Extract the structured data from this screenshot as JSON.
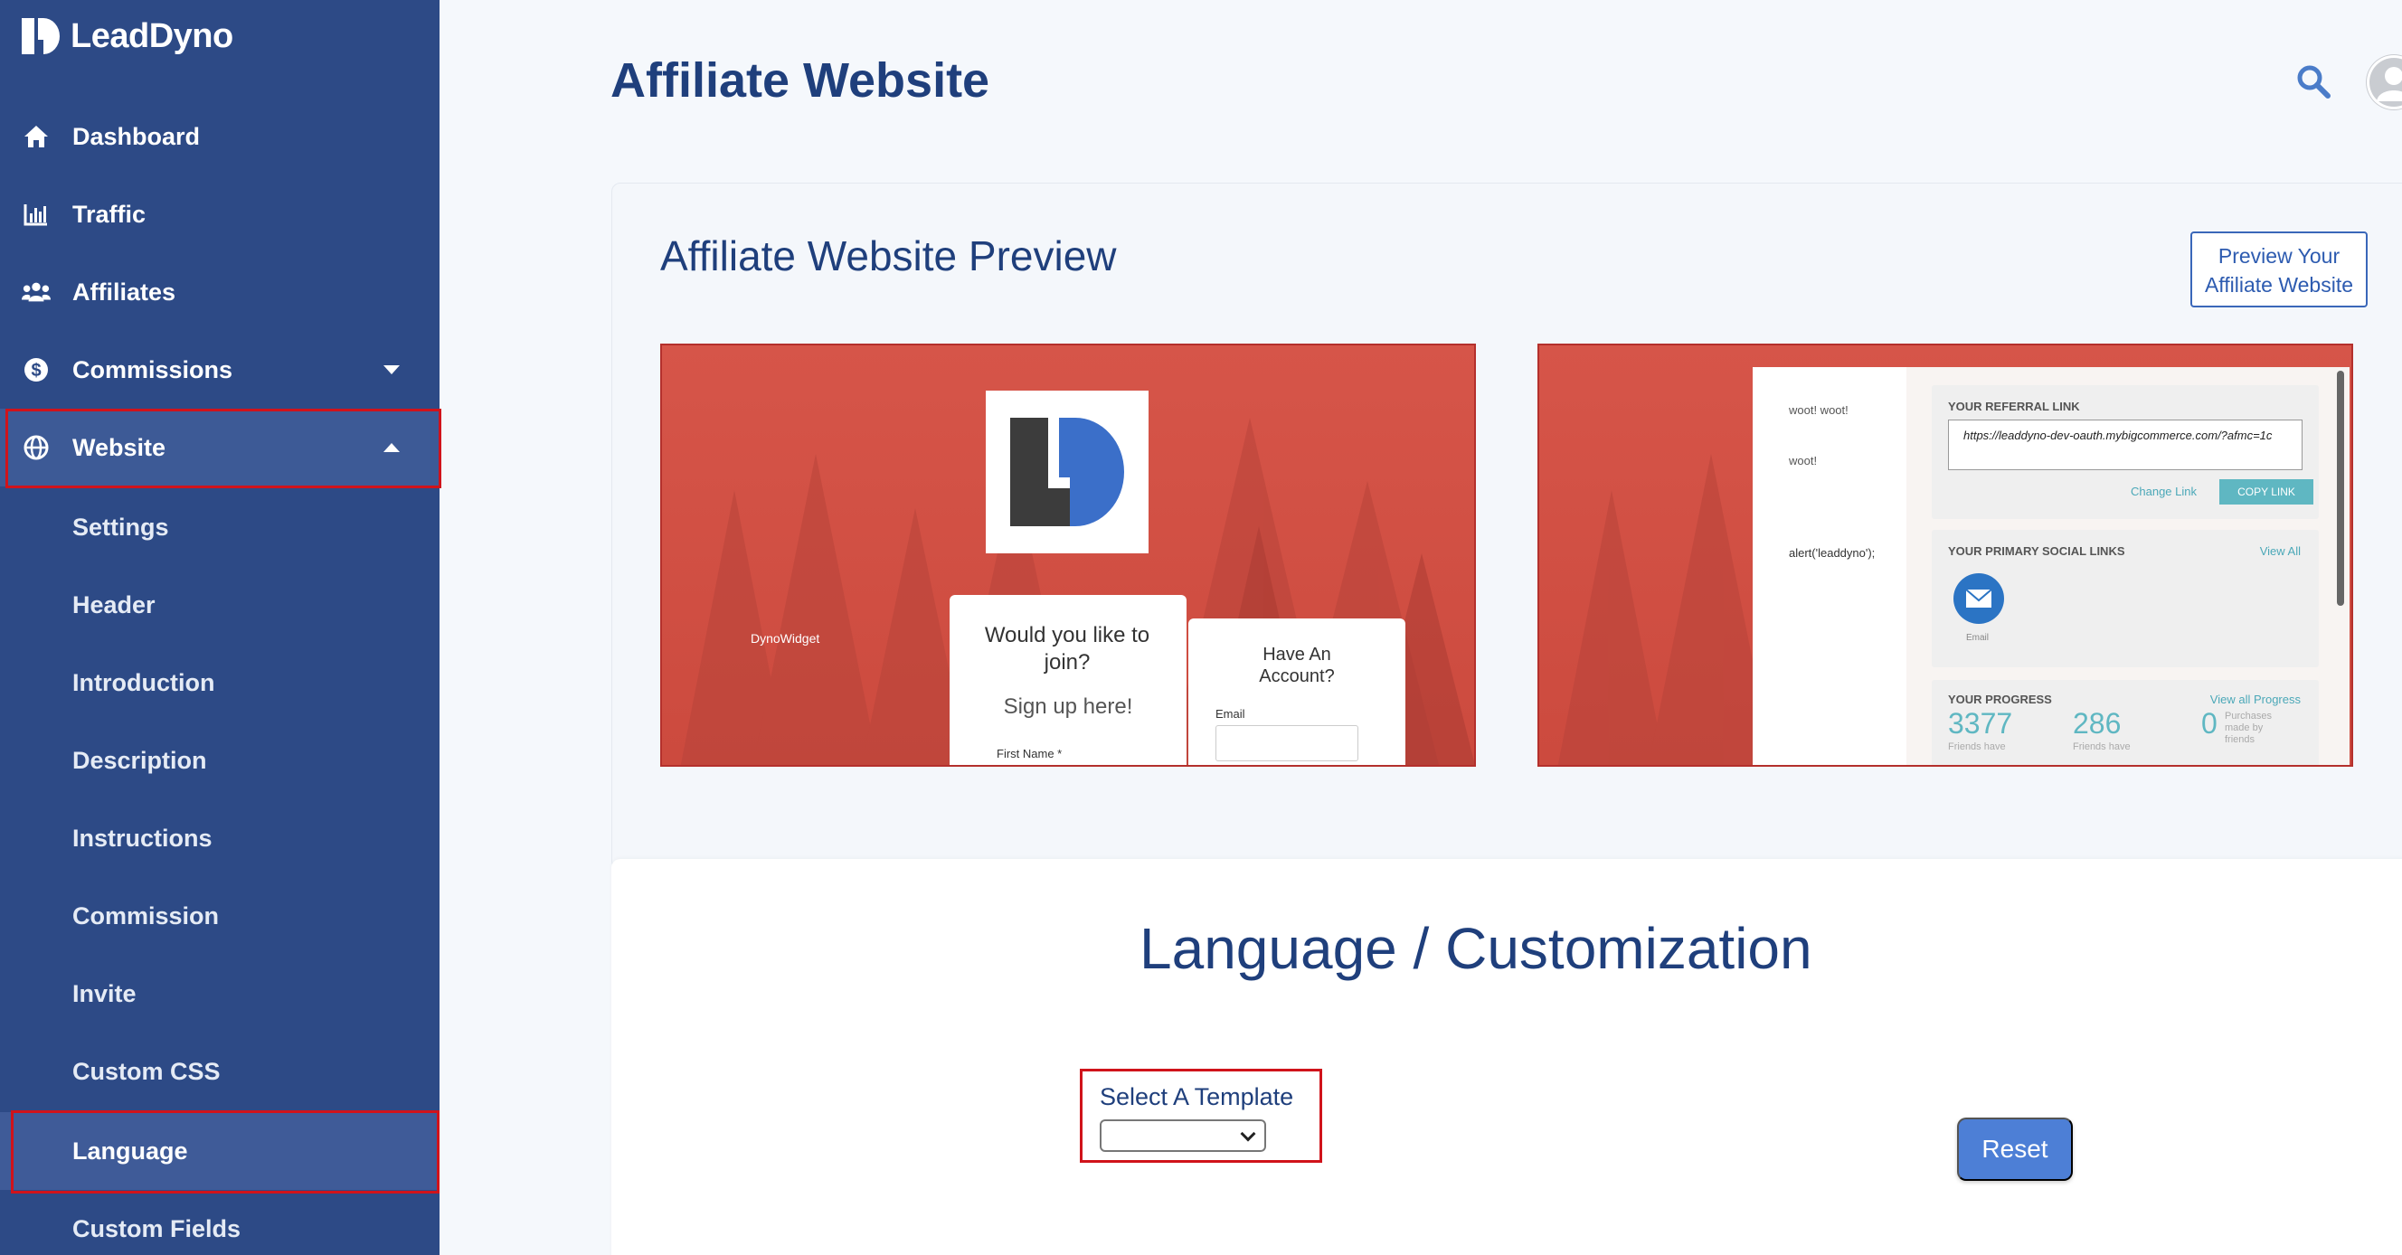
{
  "app": {
    "name": "LeadDyno"
  },
  "sidebar": {
    "items": [
      {
        "label": "Dashboard",
        "icon": "home-icon"
      },
      {
        "label": "Traffic",
        "icon": "bar-chart-icon"
      },
      {
        "label": "Affiliates",
        "icon": "users-icon"
      },
      {
        "label": "Commissions",
        "icon": "dollar-icon",
        "expanded": false
      },
      {
        "label": "Website",
        "icon": "globe-icon",
        "expanded": true
      }
    ],
    "website_sub": [
      {
        "label": "Settings"
      },
      {
        "label": "Header"
      },
      {
        "label": "Introduction"
      },
      {
        "label": "Description"
      },
      {
        "label": "Instructions"
      },
      {
        "label": "Commission"
      },
      {
        "label": "Invite"
      },
      {
        "label": "Custom CSS"
      },
      {
        "label": "Language",
        "active": true
      },
      {
        "label": "Custom Fields"
      }
    ]
  },
  "header": {
    "title": "Affiliate Website"
  },
  "preview": {
    "title": "Affiliate Website Preview",
    "button_line1": "Preview Your",
    "button_line2": "Affiliate Website",
    "left": {
      "widget_label": "DynoWidget",
      "join_title": "Would you like to join?",
      "signup": "Sign up here!",
      "first_name": "First Name *",
      "have_account": "Have An Account?",
      "email": "Email"
    },
    "right": {
      "woot1": "woot! woot!",
      "woot2": "woot!",
      "alert": "alert('leaddyno');",
      "referral_header": "YOUR REFERRAL LINK",
      "referral_url": "https://leaddyno-dev-oauth.mybigcommerce.com/?afmc=1c",
      "change_link": "Change Link",
      "copy_link": "COPY LINK",
      "social_header": "YOUR PRIMARY SOCIAL LINKS",
      "view_all": "View All",
      "email_label": "Email",
      "progress_header": "YOUR PROGRESS",
      "view_all_progress": "View all Progress",
      "stat1_value": "3377",
      "stat1_label": "Friends have",
      "stat2_value": "286",
      "stat2_label": "Friends have",
      "stat3_value": "0",
      "stat3_label": "Purchases made by friends"
    }
  },
  "language": {
    "title": "Language / Customization",
    "select_label": "Select A Template",
    "select_value": "",
    "reset_label": "Reset"
  },
  "colors": {
    "sidebar": "#2d4a86",
    "accent": "#1f3f7c",
    "highlight": "#d0131b",
    "button": "#4d7fd6"
  }
}
